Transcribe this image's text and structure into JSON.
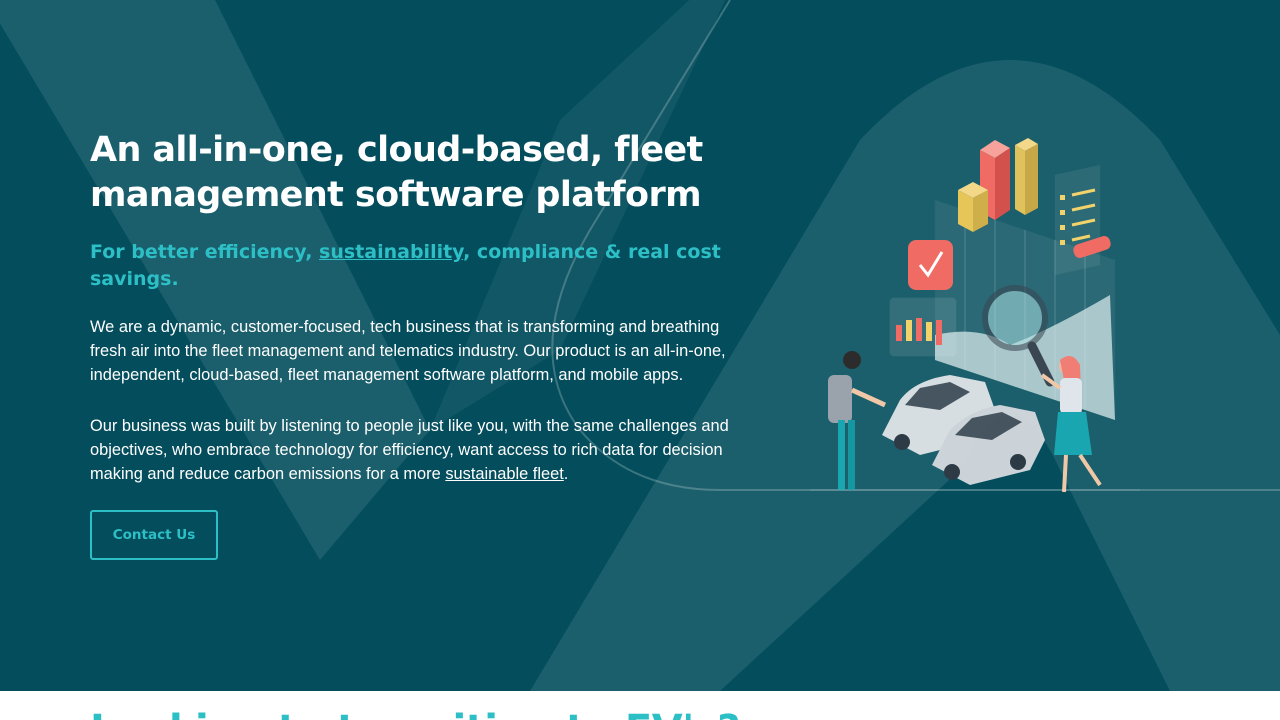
{
  "hero": {
    "title": "An all-in-one, cloud-based, fleet management software platform",
    "subtitle": {
      "before": "For better efficiency, ",
      "link": "sustainability",
      "after": ", compliance & real cost savings."
    },
    "paragraph1": "We are a dynamic, customer-focused, tech business that is transforming and breathing fresh air into the fleet management and telematics industry. Our product is an all-in-one, independent, cloud-based, fleet management software platform, and mobile apps.",
    "paragraph2": {
      "text": "Our business was built by listening to people just like you, with the same challenges and objectives, who embrace technology for efficiency, want access to rich data for decision making and reduce carbon emissions for a more ",
      "link": "sustainable fleet",
      "after": "."
    },
    "contact_button": "Contact Us"
  },
  "next_section": {
    "heading": "Looking to transition to EV's?"
  },
  "colors": {
    "hero_bg": "#034d5c",
    "accent": "#2cc0c6",
    "text": "#ffffff"
  }
}
